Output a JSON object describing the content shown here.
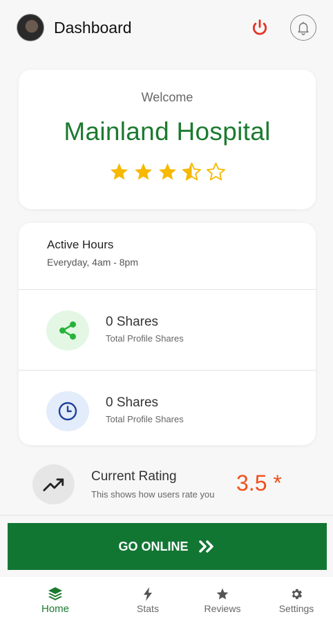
{
  "header": {
    "title": "Dashboard",
    "power_icon": "power-icon",
    "bell_icon": "bell-icon"
  },
  "welcome": {
    "label": "Welcome",
    "name": "Mainland Hospital",
    "rating_stars": 3.5,
    "rating_max": 5
  },
  "info": {
    "hours_title": "Active Hours",
    "hours_value": "Everyday, 4am - 8pm",
    "shares": {
      "value": "0 Shares",
      "label": "Total Profile Shares",
      "icon": "share-icon"
    },
    "clock": {
      "value": "0 Shares",
      "label": "Total Profile Shares",
      "icon": "clock-icon"
    }
  },
  "rating": {
    "title": "Current Rating",
    "subtitle": "This shows how users rate you",
    "value": "3.5 *",
    "icon": "trending-up-icon"
  },
  "go_online": {
    "label": "GO ONLINE",
    "icon": "double-chevron-right-icon"
  },
  "nav": [
    {
      "label": "Home",
      "icon": "layers-icon",
      "active": true
    },
    {
      "label": "Stats",
      "icon": "bolt-icon",
      "active": false
    },
    {
      "label": "Reviews",
      "icon": "star-icon",
      "active": false
    },
    {
      "label": "Settings",
      "icon": "gear-icon",
      "active": false
    }
  ],
  "colors": {
    "brand_green": "#1b7a2f",
    "button_green": "#127633",
    "star_gold": "#f6b900",
    "rating_orange": "#f0501c",
    "power_red": "#e53225"
  }
}
